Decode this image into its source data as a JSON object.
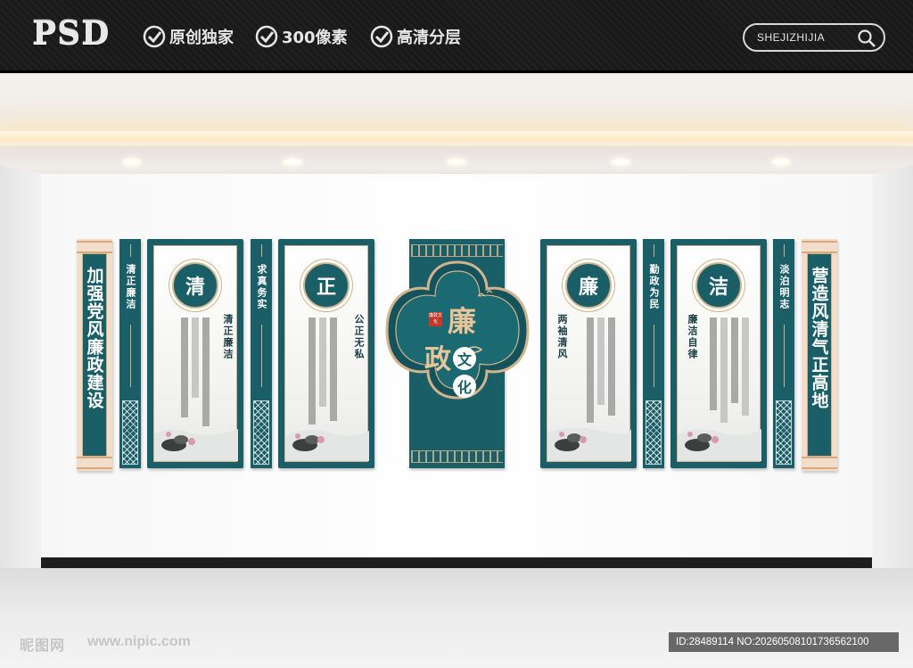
{
  "header": {
    "logo": "PSD",
    "features": [
      "原创独家",
      "300像素",
      "高清分层"
    ],
    "search_label": "SHEJIZHIJIA"
  },
  "wall": {
    "left_slogan": "加强党风廉政建设",
    "right_slogan": "营造风清气正高地",
    "narrow_panels": [
      "清正廉洁",
      "求真务实",
      "勤政为民",
      "淡泊明志"
    ],
    "tall_panels": [
      {
        "badge": "清",
        "text": "清正廉洁"
      },
      {
        "badge": "正",
        "text": "公正无私"
      },
      {
        "badge": "廉",
        "text": "两袖清风"
      },
      {
        "badge": "洁",
        "text": "廉洁自律"
      }
    ],
    "center": {
      "title_top": "廉",
      "title_bottom": "政",
      "circle1": "文",
      "circle2": "化",
      "seal": "廉政文化"
    }
  },
  "footer": {
    "site_logo": "昵图网",
    "site_url": "www.nipic.com",
    "id_text": "ID:28489114 NO:20260508101736562100"
  },
  "colors": {
    "teal": "#1a5e67",
    "gold": "#d2b48c",
    "title_gold": "#e8c49a",
    "header_bg": "#1f1f1f"
  }
}
